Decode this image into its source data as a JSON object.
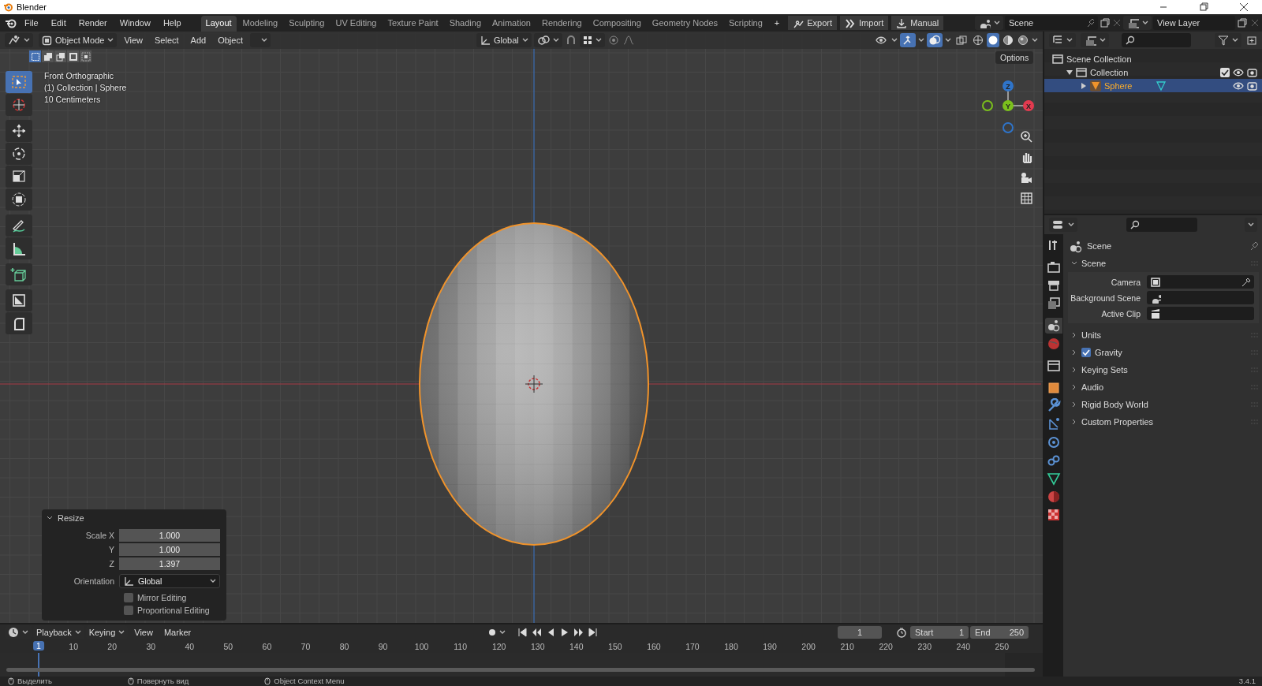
{
  "window": {
    "title": "Blender"
  },
  "menu": [
    "File",
    "Edit",
    "Render",
    "Window",
    "Help"
  ],
  "workspaces": [
    {
      "label": "Layout",
      "selected": true
    },
    {
      "label": "Modeling",
      "selected": false
    },
    {
      "label": "Sculpting",
      "selected": false
    },
    {
      "label": "UV Editing",
      "selected": false
    },
    {
      "label": "Texture Paint",
      "selected": false
    },
    {
      "label": "Shading",
      "selected": false
    },
    {
      "label": "Animation",
      "selected": false
    },
    {
      "label": "Rendering",
      "selected": false
    },
    {
      "label": "Compositing",
      "selected": false
    },
    {
      "label": "Geometry Nodes",
      "selected": false
    },
    {
      "label": "Scripting",
      "selected": false
    }
  ],
  "add_workspace": "+",
  "topbar_buttons": [
    {
      "kind": "export",
      "label": "Export"
    },
    {
      "kind": "import",
      "label": "Import"
    },
    {
      "kind": "manual",
      "label": "Manual"
    }
  ],
  "scene_field": "Scene",
  "view_layer_field": "View Layer",
  "viewport": {
    "mode": "Object Mode",
    "menus": [
      "View",
      "Select",
      "Add",
      "Object"
    ],
    "orientation": "Global",
    "toggles": [
      {
        "kind": "visibility",
        "on": false
      },
      {
        "kind": "gizmo",
        "on": true
      },
      {
        "kind": "overlay",
        "on": true
      },
      {
        "kind": "xray",
        "on": false
      }
    ],
    "shading": [
      {
        "kind": "wireframe",
        "selected": false
      },
      {
        "kind": "solid",
        "selected": true
      },
      {
        "kind": "material",
        "selected": false
      },
      {
        "kind": "rendered",
        "selected": false
      }
    ],
    "select_modes": [
      {
        "selected": true
      },
      {
        "selected": false
      },
      {
        "selected": false
      },
      {
        "selected": false
      },
      {
        "selected": false
      }
    ],
    "options": "Options",
    "info": [
      "Front Orthographic",
      "(1) Collection | Sphere",
      "10 Centimeters"
    ],
    "tools": [
      {
        "kind": "select",
        "selected": true
      },
      {
        "kind": "cursor",
        "selected": false
      },
      {
        "kind": "move",
        "selected": false
      },
      {
        "kind": "rotate",
        "selected": false
      },
      {
        "kind": "scale",
        "selected": false
      },
      {
        "kind": "transform",
        "selected": false
      },
      {
        "kind": "annotate",
        "selected": false
      },
      {
        "kind": "measure",
        "selected": false
      },
      {
        "kind": "cube",
        "selected": false
      },
      {
        "kind": "diagonal",
        "selected": false
      },
      {
        "kind": "corner",
        "selected": false
      }
    ],
    "gizmo_axes": [
      {
        "label": "Z",
        "color": "#2f74c9"
      },
      {
        "label": "Y",
        "color": "#7bc01c"
      },
      {
        "label": "X",
        "color": "#e33a4f"
      }
    ],
    "resize_panel": {
      "title": "Resize",
      "expanded": true,
      "fields": [
        {
          "label": "Scale X",
          "value": "1.000"
        },
        {
          "label": "Y",
          "value": "1.000"
        },
        {
          "label": "Z",
          "value": "1.397"
        }
      ],
      "orientation": {
        "label": "Orientation",
        "value": "Global"
      },
      "checkboxes": [
        {
          "label": "Mirror Editing",
          "checked": false
        },
        {
          "label": "Proportional Editing",
          "checked": false
        }
      ]
    }
  },
  "outliner": {
    "tree": [
      {
        "label": "Scene Collection",
        "selected": false,
        "children": [
          {
            "label": "Collection",
            "selected": false,
            "expanded": true,
            "checked": true,
            "children": [
              {
                "label": "Sphere",
                "selected": true,
                "expanded": false
              }
            ]
          }
        ]
      }
    ]
  },
  "properties": {
    "tabs": [
      {
        "kind": "tool",
        "selected": false
      },
      {
        "kind": "render",
        "selected": false
      },
      {
        "kind": "output",
        "selected": false
      },
      {
        "kind": "viewlayer",
        "selected": false
      },
      {
        "kind": "scene",
        "selected": true
      },
      {
        "kind": "world",
        "selected": false
      },
      {
        "kind": "collection",
        "selected": false
      },
      {
        "kind": "object",
        "selected": false
      },
      {
        "kind": "modifier",
        "selected": false
      },
      {
        "kind": "particles",
        "selected": false
      },
      {
        "kind": "physics",
        "selected": false
      },
      {
        "kind": "constraint",
        "selected": false
      },
      {
        "kind": "data",
        "selected": false
      },
      {
        "kind": "material",
        "selected": false
      },
      {
        "kind": "texture",
        "selected": false
      }
    ],
    "header": "Scene",
    "panels": [
      {
        "kind": "plain",
        "label": "Scene",
        "expanded": true,
        "fields": [
          {
            "kind": "camera",
            "label": "Camera"
          },
          {
            "kind": "scene",
            "label": "Background Scene"
          },
          {
            "kind": "clip",
            "label": "Active Clip"
          }
        ]
      },
      {
        "kind": "plain",
        "label": "Units",
        "expanded": false
      },
      {
        "kind": "checkbox",
        "label": "Gravity",
        "expanded": false,
        "checked": true
      },
      {
        "kind": "plain",
        "label": "Keying Sets",
        "expanded": false
      },
      {
        "kind": "plain",
        "label": "Audio",
        "expanded": false
      },
      {
        "kind": "plain",
        "label": "Rigid Body World",
        "expanded": false
      },
      {
        "kind": "plain",
        "label": "Custom Properties",
        "expanded": false
      }
    ]
  },
  "timeline": {
    "menus": [
      "Playback",
      "Keying",
      "View",
      "Marker"
    ],
    "frame": "1",
    "start_label": "Start",
    "start": "1",
    "end_label": "End",
    "end": "250",
    "current": "1",
    "ruler": [
      "10",
      "20",
      "30",
      "40",
      "50",
      "60",
      "70",
      "80",
      "90",
      "100",
      "110",
      "120",
      "130",
      "140",
      "150",
      "160",
      "170",
      "180",
      "190",
      "200",
      "210",
      "220",
      "230",
      "240",
      "250"
    ]
  },
  "status_bar": {
    "items": [
      "Выделить",
      "Повернуть вид",
      "Object Context Menu"
    ],
    "version": "3.4.1"
  }
}
